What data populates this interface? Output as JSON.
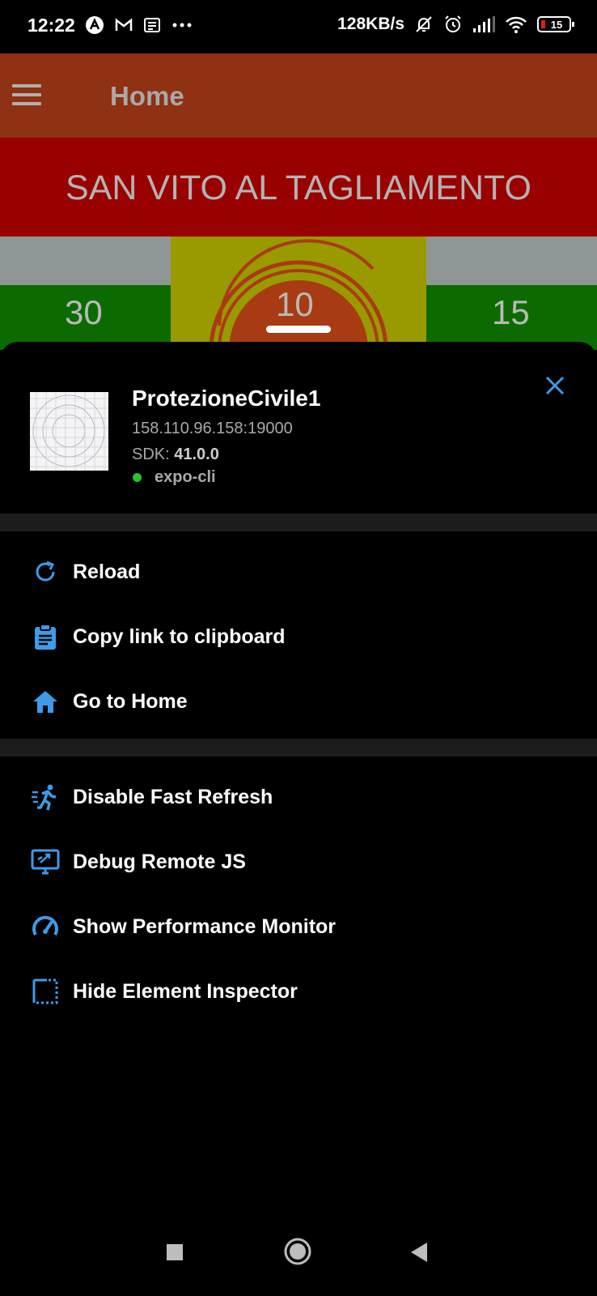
{
  "status_bar": {
    "time": "12:22",
    "network_speed": "128KB/s",
    "battery": "15",
    "icons": [
      "notification-a-icon",
      "gmail-icon",
      "news-icon",
      "more-dots-icon",
      "mute-icon",
      "alarm-icon",
      "signal-icon",
      "wifi-icon",
      "battery-icon"
    ]
  },
  "app_bar": {
    "title": "Home",
    "menu_icon": "hamburger-icon"
  },
  "city": {
    "name": "SAN VITO AL TAGLIAMENTO"
  },
  "gauges": {
    "left_value": "30",
    "center_value": "10",
    "right_value": "15"
  },
  "dev_menu": {
    "project_name": "ProtezioneCivile1",
    "url": "158.110.96.158:19000",
    "sdk_label": "SDK:",
    "sdk_version": "41.0.0",
    "host": "expo-cli",
    "host_status_color": "#22c82b",
    "accent_color": "#3d9be9",
    "group1": [
      {
        "label": "Reload",
        "icon": "reload-icon"
      },
      {
        "label": "Copy link to clipboard",
        "icon": "clipboard-icon"
      },
      {
        "label": "Go to Home",
        "icon": "home-icon"
      }
    ],
    "group2": [
      {
        "label": "Disable Fast Refresh",
        "icon": "running-icon"
      },
      {
        "label": "Debug Remote JS",
        "icon": "monitor-icon"
      },
      {
        "label": "Show Performance Monitor",
        "icon": "speedometer-icon"
      },
      {
        "label": "Hide Element Inspector",
        "icon": "inspector-icon"
      }
    ]
  },
  "nav_bar": {
    "buttons": [
      "recents-button",
      "home-button",
      "back-button"
    ]
  }
}
